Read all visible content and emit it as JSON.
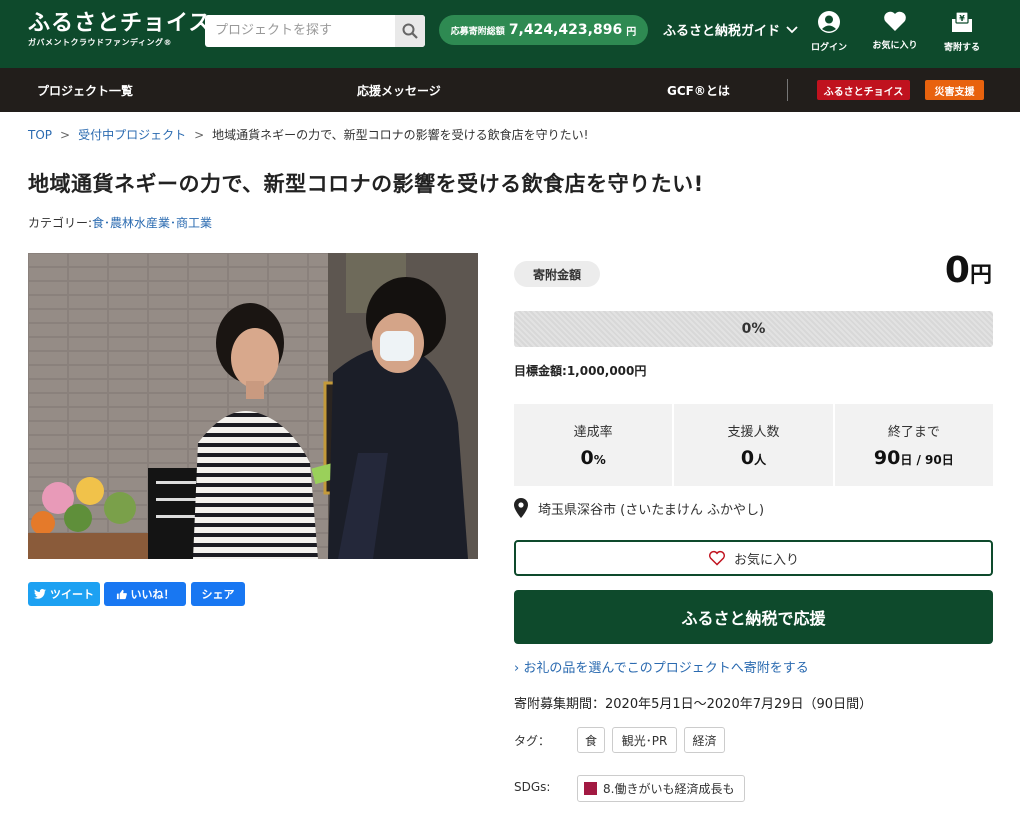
{
  "header": {
    "logo_main": "ふるさとチョイス",
    "logo_sub": "ガバメントクラウドファンディング®",
    "search_placeholder": "プロジェクトを探す",
    "total_label": "応募寄附総額",
    "total_value": "7,424,423,896",
    "total_unit": "円",
    "guide_label": "ふるさと納税ガイド",
    "login_label": "ログイン",
    "favorites_label": "お気に入り",
    "donate_label": "寄附する"
  },
  "nav": {
    "projects": "プロジェクト一覧",
    "messages": "応援メッセージ",
    "gcf": "GCF®とは",
    "choice_badge": "ふるさとチョイス",
    "disaster_badge": "災害支援",
    "colors": {
      "choice": "#c0121e",
      "disaster": "#e8620e"
    }
  },
  "breadcrumb": [
    "TOP",
    "受付中プロジェクト",
    "地域通貨ネギーの力で、新型コロナの影響を受ける飲食店を守りたい!"
  ],
  "project": {
    "title": "地域通貨ネギーの力で、新型コロナの影響を受ける飲食店を守りたい!",
    "category_label": "カテゴリー:",
    "category_value": "食･農林水産業･商工業"
  },
  "social": {
    "tweet": "ツイート",
    "like": "いいね！",
    "share": "シェア"
  },
  "panel": {
    "amount_label": "寄附金額",
    "amount_value": "0",
    "amount_unit": "円",
    "progress_pct": 0,
    "progress_text": "0%",
    "goal_label": "目標金額:",
    "goal_value": "1,000,000円",
    "stats": [
      {
        "label": "達成率",
        "value": "0",
        "unit": "%"
      },
      {
        "label": "支援人数",
        "value": "0",
        "unit": "人"
      },
      {
        "label": "終了まで",
        "value": "90",
        "unit": "日 / 90日"
      }
    ],
    "location": "埼玉県深谷市 (さいたまけん ふかやし)",
    "favorite_button": "お気に入り",
    "donate_button": "ふるさと納税で応援",
    "gift_link": "お礼の品を選んでこのプロジェクトへ寄附をする",
    "period": "寄附募集期間：2020年5月1日～2020年7月29日（90日間）",
    "tags_label": "タグ：",
    "tags": [
      "食",
      "観光･PR",
      "経済"
    ],
    "sdgs_label": "SDGs:",
    "sdgs": [
      "8.働きがいも経済成長も"
    ]
  }
}
